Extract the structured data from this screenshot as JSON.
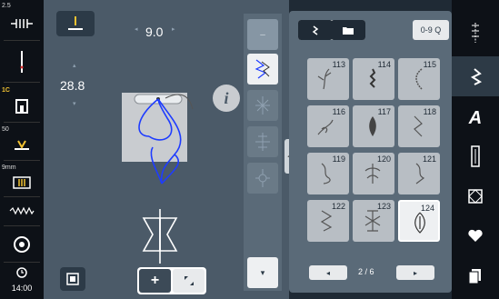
{
  "left_bar": {
    "top_value": "2.5",
    "presser_value": "1C",
    "tension_value": "50",
    "stitch_width_value": "9mm",
    "clock": "14:00"
  },
  "main": {
    "stitch_width": "9.0",
    "stitch_length": "28.8"
  },
  "right_panel": {
    "search_label": "0-9 Q",
    "page_indicator": "2 / 6",
    "stitches": [
      {
        "num": "113"
      },
      {
        "num": "114"
      },
      {
        "num": "115"
      },
      {
        "num": "116"
      },
      {
        "num": "117"
      },
      {
        "num": "118"
      },
      {
        "num": "119"
      },
      {
        "num": "120"
      },
      {
        "num": "121"
      },
      {
        "num": "122"
      },
      {
        "num": "123"
      },
      {
        "num": "124"
      }
    ],
    "selected_stitch": "124"
  },
  "right_bar": {
    "alphabet_label": "A"
  },
  "colors": {
    "accent_blue": "#1e3cff",
    "background": "#4b5a68"
  }
}
